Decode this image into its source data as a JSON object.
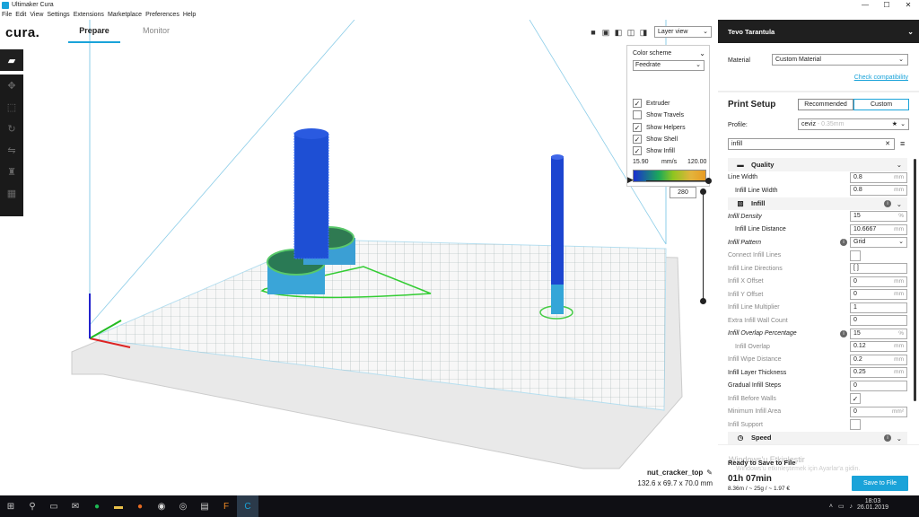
{
  "window": {
    "title": "Ultimaker Cura",
    "buttons": [
      "—",
      "☐",
      "✕"
    ]
  },
  "menu": [
    "File",
    "Edit",
    "View",
    "Settings",
    "Extensions",
    "Marketplace",
    "Preferences",
    "Help"
  ],
  "header": {
    "logo": "cura.",
    "tabs": [
      {
        "label": "Prepare",
        "active": true
      },
      {
        "label": "Monitor",
        "active": false
      }
    ],
    "view_select": "Layer view",
    "view_icons": [
      "3d-view-icon",
      "front-view-icon",
      "top-view-icon",
      "left-view-icon",
      "right-view-icon"
    ]
  },
  "toolbar": {
    "tools": [
      "open-folder-icon",
      "move-icon",
      "scale-icon",
      "rotate-icon",
      "mirror-icon",
      "per-model-settings-icon",
      "support-blocker-icon"
    ]
  },
  "color_scheme": {
    "label": "Color scheme",
    "selected": "Feedrate",
    "checkboxes": [
      {
        "label": "Extruder",
        "checked": true
      },
      {
        "label": "Show Travels",
        "checked": false
      },
      {
        "label": "Show Helpers",
        "checked": true
      },
      {
        "label": "Show Shell",
        "checked": true
      },
      {
        "label": "Show Infill",
        "checked": true
      }
    ],
    "legend_min": "15.90",
    "legend_unit": "mm/s",
    "legend_max": "120.00"
  },
  "layer_slider": {
    "value": "280"
  },
  "object": {
    "name": "nut_cracker_top",
    "dimensions": "132.6 x 69.7 x 70.0 mm"
  },
  "sidebar": {
    "printer": "Tevo Tarantula",
    "material_label": "Material",
    "material": "Custom Material",
    "compat_link": "Check compatibility",
    "print_setup_title": "Print Setup",
    "mode_recommended": "Recommended",
    "mode_custom": "Custom",
    "profile_label": "Profile:",
    "profile_value": "ceviz",
    "profile_sub": "- 0.35mm",
    "search_value": "infill",
    "settings": [
      {
        "type": "cat",
        "label": "Quality",
        "icon": "quality-icon"
      },
      {
        "type": "row",
        "label": "Line Width",
        "value": "0.8",
        "unit": "mm"
      },
      {
        "type": "row",
        "label": "Infill Line Width",
        "value": "0.8",
        "unit": "mm",
        "indent": true
      },
      {
        "type": "cat",
        "label": "Infill",
        "icon": "infill-icon",
        "info": true
      },
      {
        "type": "row",
        "label": "Infill Density",
        "value": "15",
        "unit": "%",
        "italic": true
      },
      {
        "type": "row",
        "label": "Infill Line Distance",
        "value": "10.6667",
        "unit": "mm",
        "indent": true
      },
      {
        "type": "row",
        "label": "Infill Pattern",
        "value": "Grid",
        "dropdown": true,
        "italic": true,
        "info": true
      },
      {
        "type": "row",
        "label": "Connect Infill Lines",
        "check": false,
        "dim": true
      },
      {
        "type": "row",
        "label": "Infill Line Directions",
        "value": "[ ]",
        "dim": true
      },
      {
        "type": "row",
        "label": "Infill X Offset",
        "value": "0",
        "unit": "mm",
        "dim": true
      },
      {
        "type": "row",
        "label": "Infill Y Offset",
        "value": "0",
        "unit": "mm",
        "dim": true
      },
      {
        "type": "row",
        "label": "Infill Line Multiplier",
        "value": "1",
        "dim": true
      },
      {
        "type": "row",
        "label": "Extra Infill Wall Count",
        "value": "0",
        "dim": true
      },
      {
        "type": "row",
        "label": "Infill Overlap Percentage",
        "value": "15",
        "unit": "%",
        "italic": true,
        "info": true
      },
      {
        "type": "row",
        "label": "Infill Overlap",
        "value": "0.12",
        "unit": "mm",
        "indent": true,
        "dim": true
      },
      {
        "type": "row",
        "label": "Infill Wipe Distance",
        "value": "0.2",
        "unit": "mm",
        "dim": true
      },
      {
        "type": "row",
        "label": "Infill Layer Thickness",
        "value": "0.25",
        "unit": "mm"
      },
      {
        "type": "row",
        "label": "Gradual Infill Steps",
        "value": "0"
      },
      {
        "type": "row",
        "label": "Infill Before Walls",
        "check": true,
        "dim": true
      },
      {
        "type": "row",
        "label": "Minimum Infill Area",
        "value": "0",
        "unit": "mm²",
        "dim": true
      },
      {
        "type": "row",
        "label": "Infill Support",
        "check": false,
        "dim": true
      },
      {
        "type": "cat",
        "label": "Speed",
        "icon": "speed-icon",
        "info": true
      }
    ],
    "ready_label": "Ready to Save to File",
    "print_time": "01h 07min",
    "print_stats": "8.36m / ~ 25g / ~ 1.97 €",
    "save_button": "Save to File",
    "watermark": "Windows'u Etkinleştir",
    "watermark_sub": "Windows'u etkinleştirmek için Ayarlar'a gidin."
  },
  "taskbar": {
    "icons": [
      "windows-start-icon",
      "search-icon",
      "task-view-icon",
      "mail-icon",
      "spotify-icon",
      "file-explorer-icon",
      "firefox-icon",
      "chrome-icon",
      "steam-icon",
      "app-icon",
      "fusion-icon",
      "cura-icon"
    ],
    "time": "18:03",
    "date": "26.01.2019"
  }
}
